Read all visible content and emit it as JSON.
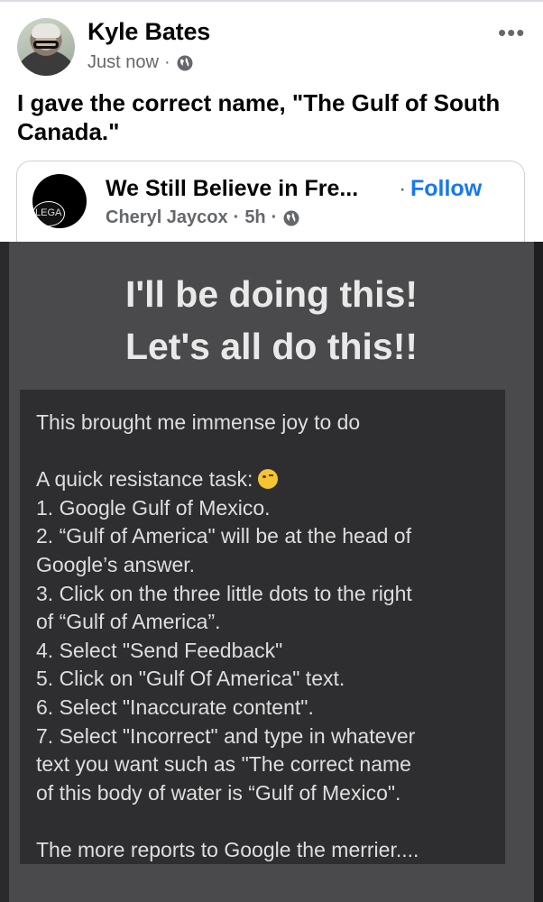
{
  "post": {
    "author": "Kyle Bates",
    "time": "Just now",
    "text": "I gave the correct name, \"The Gulf of South Canada.\""
  },
  "shared": {
    "page_name": "We Still Believe in Fre...",
    "separator": "·",
    "follow_label": "Follow",
    "poster": "Cheryl Jaycox",
    "time": "5h",
    "avatar_text": "LEGA"
  },
  "image": {
    "headline_1": "I'll be doing this!",
    "headline_2": "Let's all do this!!",
    "lines": [
      "This brought me immense joy to do",
      "",
      "A quick resistance task:",
      "1. Google Gulf of Mexico.",
      "2. “Gulf of America\" will be at the head of",
      "Google’s answer.",
      "3. Click on the three little dots to the right",
      "of “Gulf of America”.",
      "4. Select \"Send Feedback\"",
      "5. Click on \"Gulf Of America\" text.",
      "6. Select \"Inaccurate content\".",
      "7. Select \"Incorrect\" and type in whatever",
      "text you want such as \"The correct name",
      "of this body of water is “Gulf of Mexico\".",
      "",
      "The more reports to Google the merrier...."
    ]
  },
  "icons": [
    "globe-icon",
    "more-options-icon",
    "wink-emoji-icon"
  ]
}
